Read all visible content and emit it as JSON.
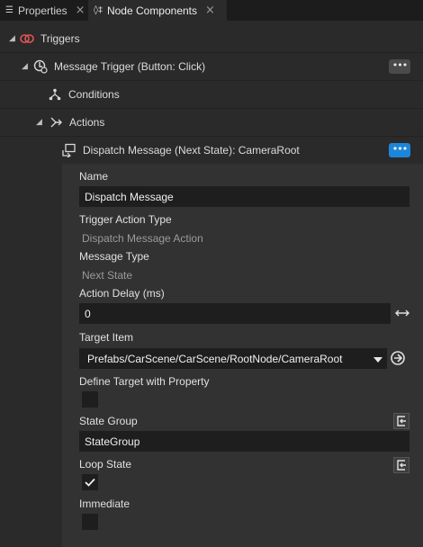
{
  "tabs": [
    {
      "label": "Properties",
      "close": "×",
      "icon": "list-icon"
    },
    {
      "label": "Node Components",
      "close": "×",
      "icon": "node-components-icon"
    }
  ],
  "tree": {
    "triggers": {
      "label": "Triggers",
      "icon": "trigger-icon"
    },
    "message_trigger": {
      "label": "Message Trigger (Button: Click)",
      "more": "•••"
    },
    "conditions": {
      "label": "Conditions"
    },
    "actions": {
      "label": "Actions"
    },
    "dispatch": {
      "label": "Dispatch Message (Next State): CameraRoot",
      "more": "•••"
    }
  },
  "properties": {
    "name": {
      "label": "Name",
      "value": "Dispatch Message"
    },
    "trigger_action_type": {
      "label": "Trigger Action Type",
      "value": "Dispatch Message Action"
    },
    "message_type": {
      "label": "Message Type",
      "value": "Next State"
    },
    "action_delay": {
      "label": "Action Delay (ms)",
      "value": "0"
    },
    "target_item": {
      "label": "Target Item",
      "value": "Prefabs/CarScene/CarScene/RootNode/CameraRoot"
    },
    "define_target": {
      "label": "Define Target with Property",
      "checked": false
    },
    "state_group": {
      "label": "State Group",
      "value": "StateGroup"
    },
    "loop_state": {
      "label": "Loop State",
      "checked": true
    },
    "immediate": {
      "label": "Immediate",
      "checked": false
    }
  },
  "colors": {
    "accent": "#1d86d9",
    "trigger_icon": "#e05555"
  }
}
